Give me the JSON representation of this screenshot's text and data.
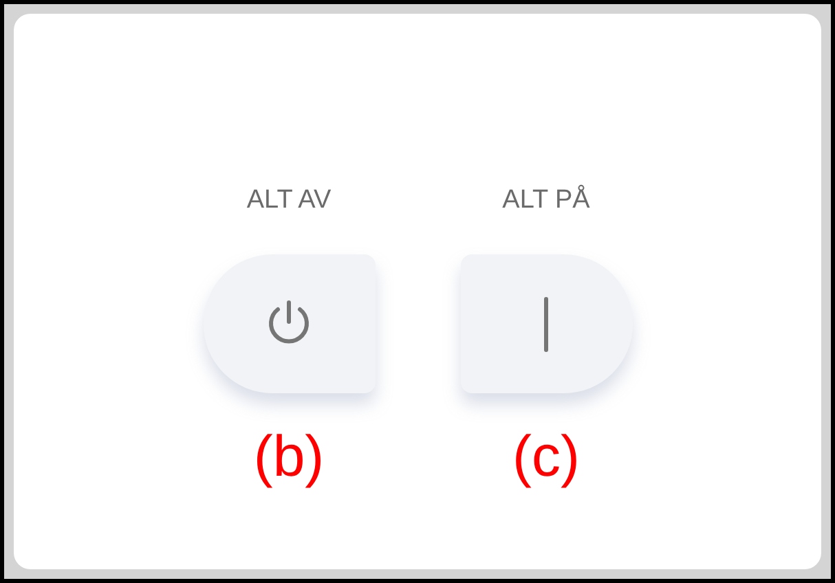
{
  "switches": [
    {
      "label": "ALT AV",
      "kind": "off",
      "caption": "(b)"
    },
    {
      "label": "ALT PÅ",
      "kind": "on",
      "caption": "(c)"
    }
  ]
}
